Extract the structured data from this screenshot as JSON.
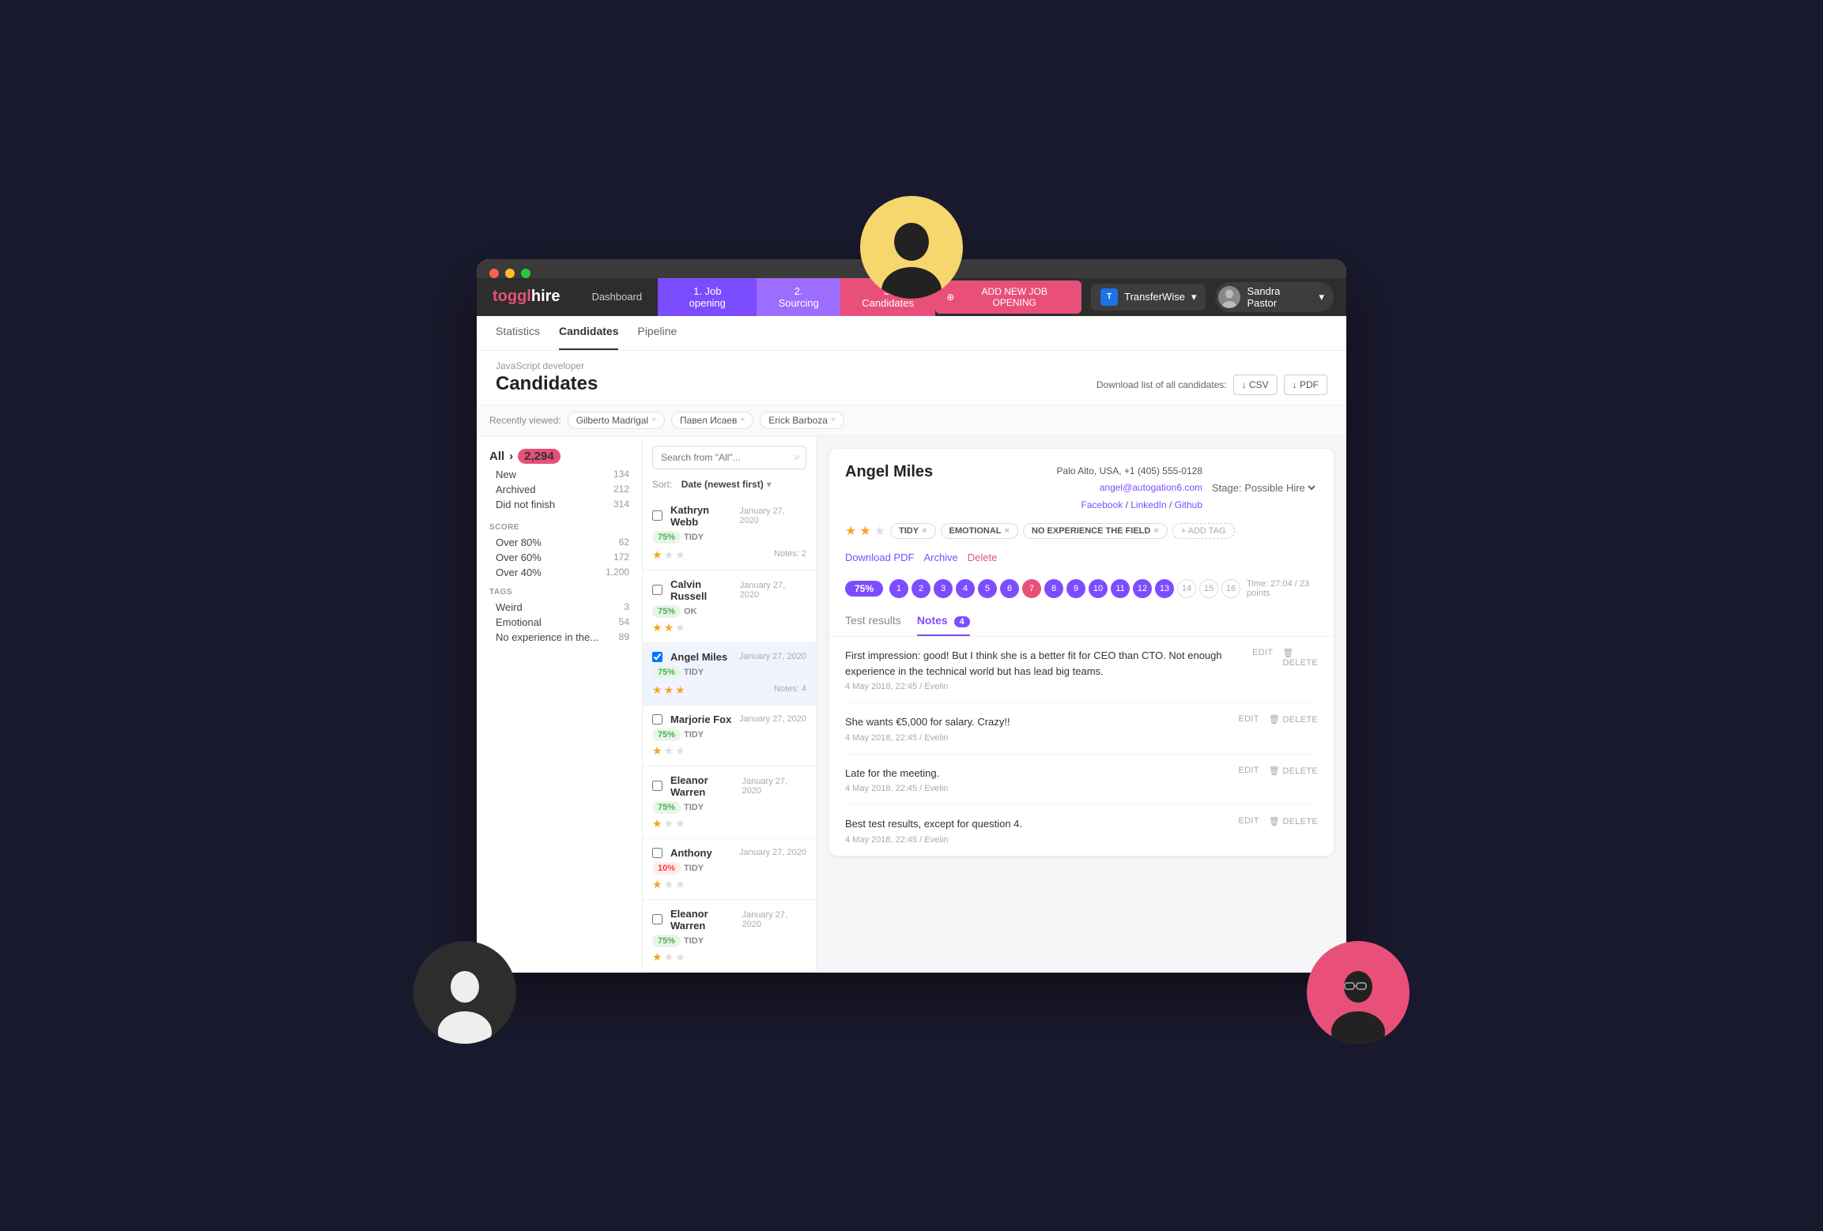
{
  "app": {
    "title": "Toggl Hire",
    "logo_prefix": "toggl",
    "logo_suffix": "hire"
  },
  "topbar": {
    "nav": [
      {
        "label": "Dashboard",
        "id": "dashboard"
      },
      {
        "label": "1. Job opening",
        "id": "job-opening"
      },
      {
        "label": "2. Sourcing",
        "id": "sourcing"
      },
      {
        "label": "3. Candidates",
        "id": "candidates"
      }
    ],
    "add_job_btn": "ADD NEW JOB OPENING",
    "company": "TransferWise",
    "user": "Sandra Pastor"
  },
  "sub_nav": {
    "items": [
      {
        "label": "Statistics",
        "id": "statistics"
      },
      {
        "label": "Candidates",
        "id": "candidates"
      },
      {
        "label": "Pipeline",
        "id": "pipeline"
      }
    ],
    "active": "candidates"
  },
  "page_header": {
    "job_type": "JavaScript developer",
    "title": "Candidates",
    "download_label": "Download list of all candidates:",
    "csv_btn": "↓ CSV",
    "pdf_btn": "↓ PDF"
  },
  "recently_viewed": {
    "label": "Recently viewed:",
    "chips": [
      {
        "name": "Gilberto Madrigal"
      },
      {
        "name": "Павел Исаев"
      },
      {
        "name": "Erick Barboza"
      }
    ]
  },
  "left_panel": {
    "all_label": "All",
    "all_count": "2,294",
    "filters": [
      {
        "label": "New",
        "count": "134"
      },
      {
        "label": "Archived",
        "count": "212"
      },
      {
        "label": "Did not finish",
        "count": "314"
      }
    ],
    "score_title": "SCORE",
    "scores": [
      {
        "label": "Over 80%",
        "count": "62"
      },
      {
        "label": "Over 60%",
        "count": "172"
      },
      {
        "label": "Over 40%",
        "count": "1,200"
      }
    ],
    "tags_title": "TAGS",
    "tags": [
      {
        "label": "Weird",
        "count": "3"
      },
      {
        "label": "Emotional",
        "count": "54"
      },
      {
        "label": "No experience in the...",
        "count": "89"
      }
    ]
  },
  "search": {
    "placeholder": "Search from \"All\"..."
  },
  "sort": {
    "label": "Sort:",
    "value": "Date (newest first)"
  },
  "candidates": [
    {
      "name": "Kathryn Webb",
      "date": "January 27, 2020",
      "score": "75%",
      "score_type": "green",
      "tag": "TIDY",
      "stars": 1,
      "notes": "Notes: 2"
    },
    {
      "name": "Calvin Russell",
      "date": "January 27, 2020",
      "score": "75%",
      "score_type": "green",
      "tag": "OK",
      "stars": 2,
      "notes": ""
    },
    {
      "name": "Angel Miles",
      "date": "January 27, 2020",
      "score": "75%",
      "score_type": "green",
      "tag": "TIDY",
      "stars": 3,
      "notes": "Notes: 4",
      "selected": true
    },
    {
      "name": "Marjorie Fox",
      "date": "January 27, 2020",
      "score": "75%",
      "score_type": "green",
      "tag": "TIDY",
      "stars": 1,
      "notes": ""
    },
    {
      "name": "Eleanor Warren",
      "date": "January 27, 2020",
      "score": "75%",
      "score_type": "green",
      "tag": "TIDY",
      "stars": 1,
      "notes": ""
    },
    {
      "name": "Anthony",
      "date": "January 27, 2020",
      "score": "10%",
      "score_type": "red",
      "tag": "TIDY",
      "stars": 1,
      "notes": ""
    },
    {
      "name": "Eleanor Warren",
      "date": "January 27, 2020",
      "score": "75%",
      "score_type": "green",
      "tag": "TIDY",
      "stars": 1,
      "notes": ""
    }
  ],
  "detail": {
    "name": "Angel Miles",
    "stage_label": "Stage: Possible Hire",
    "tags": [
      "TIDY",
      "EMOTIONAL",
      "NO EXPERIENCE THE FIELD"
    ],
    "contact": {
      "location": "Palo Alto, USA, +1 (405) 555-0128",
      "email": "angel@autogation6.com",
      "links": [
        "Facebook",
        "LinkedIn",
        "Github"
      ]
    },
    "score_pct": "75%",
    "steps": [
      1,
      2,
      3,
      4,
      5,
      6,
      7,
      8,
      9,
      10,
      11,
      12,
      13,
      14,
      15,
      16
    ],
    "filled_steps": [
      1,
      2,
      3,
      4,
      5,
      6,
      7,
      8,
      9,
      10,
      11,
      12,
      13
    ],
    "time": "Time: 27:04",
    "points": "23 points",
    "actions": [
      "Download PDF",
      "Archive",
      "Delete"
    ],
    "tabs": [
      {
        "label": "Test results",
        "count": null
      },
      {
        "label": "Notes",
        "count": "4"
      }
    ],
    "active_tab": "Notes",
    "notes": [
      {
        "text": "First impression: good! But I think she is a better fit for CEO than CTO. Not enough experience in the technical world but has lead big teams.",
        "meta": "4 May 2018, 22:45 / Evelin"
      },
      {
        "text": "She wants €5,000 for salary. Crazy!!",
        "meta": "4 May 2018, 22:45 / Evelin"
      },
      {
        "text": "Late for the meeting.",
        "meta": "4 May 2018, 22:45 / Evelin"
      },
      {
        "text": "Best test results, except for question 4.",
        "meta": "4 May 2018, 22:45 / Evelin"
      }
    ]
  },
  "icons": {
    "plus": "+",
    "search": "⌕",
    "download": "↓",
    "chevron_down": "▾",
    "close": "×",
    "edit": "✎",
    "trash": "🗑"
  }
}
